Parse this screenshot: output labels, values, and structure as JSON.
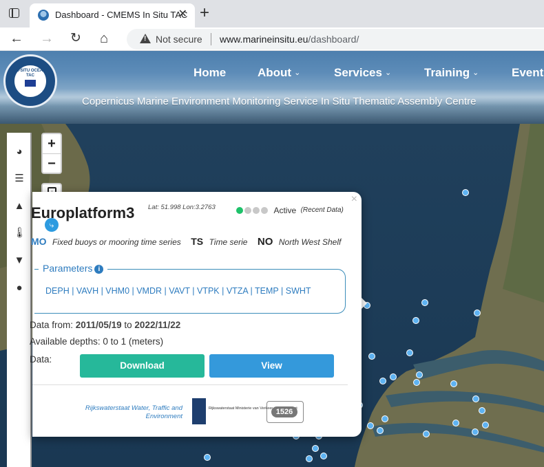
{
  "browser": {
    "tab_title": "Dashboard - CMEMS In Situ TAC",
    "tab_close": "✕",
    "new_tab": "+",
    "security_label": "Not secure",
    "url_host": "www.marineinsitu.eu",
    "url_path": "/dashboard/"
  },
  "header": {
    "logo_text": "IN-SITU OCEAN TAC",
    "nav": [
      {
        "label": "Home",
        "has_dropdown": false
      },
      {
        "label": "About",
        "has_dropdown": true
      },
      {
        "label": "Services",
        "has_dropdown": true
      },
      {
        "label": "Training",
        "has_dropdown": true
      },
      {
        "label": "Events",
        "has_dropdown": false
      }
    ],
    "tagline": "Copernicus Marine Environment Monitoring Service In Situ Thematic Assembly Centre"
  },
  "map_controls": {
    "zoom_in": "+",
    "zoom_out": "−"
  },
  "popup": {
    "platform_name": "Europlatform3",
    "lat_lon": "Lat: 51.998 Lon:3.2763",
    "status_dots": [
      true,
      false,
      false,
      false
    ],
    "status_label": "Active",
    "status_note": "(Recent Data)",
    "type_code": "MO",
    "type_desc": "Fixed buoys or mooring time series",
    "data_code": "TS",
    "data_desc": "Time serie",
    "region_code": "NO",
    "region_desc": "North West Shelf",
    "parameters_label": "Parameters",
    "parameters": "DEPH | VAVH | VHM0 | VMDR | VAVT | VTPK | VTZA | TEMP | SWHT",
    "data_from_label": "Data from:",
    "date_from": "2011/05/19",
    "date_to_word": "to",
    "date_to": "2022/11/22",
    "depths": "Available depths: 0 to 1 (meters)",
    "data_label": "Data:",
    "download_label": "Download",
    "view_label": "View",
    "provider": "Rijkswaterstaat Water, Traffic and Environment",
    "provider_logo_text": "Rijkswaterstaat Ministerie van Verkeer en Waterstaat",
    "count": "1526",
    "close": "×"
  },
  "colors": {
    "accent_blue": "#2e7cbf",
    "download_green": "#26b89a",
    "view_blue": "#3499db",
    "station_marker": "#5eb3f2"
  }
}
